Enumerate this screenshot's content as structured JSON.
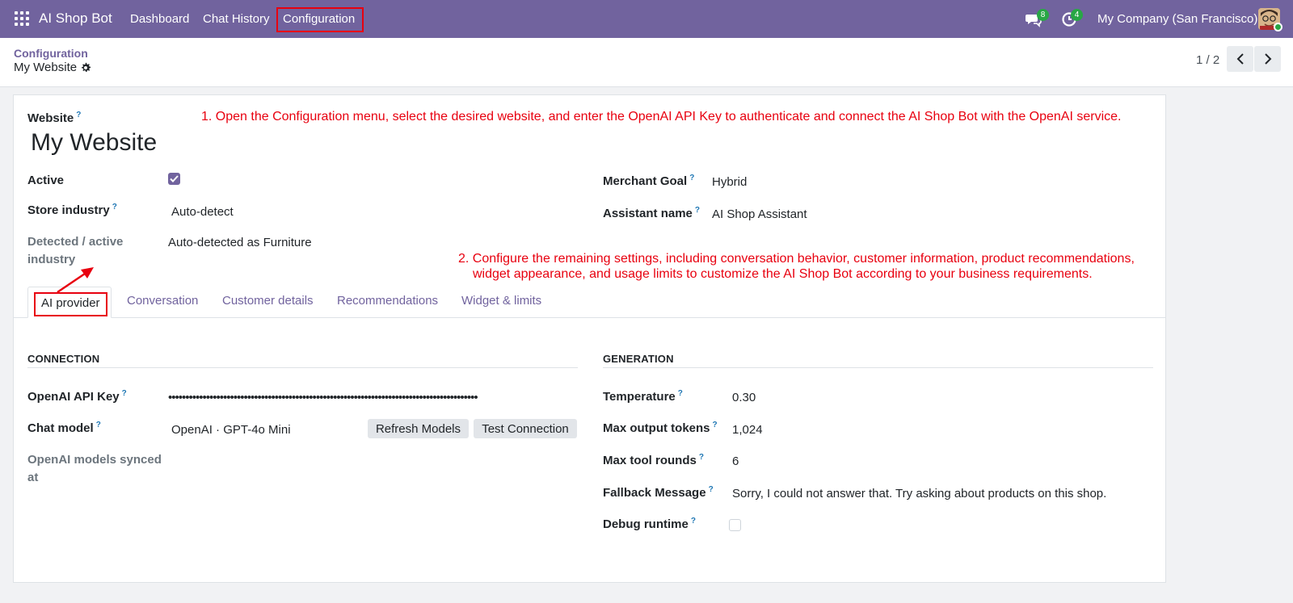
{
  "navbar": {
    "brand": "AI Shop Bot",
    "items": [
      "Dashboard",
      "Chat History",
      "Configuration"
    ],
    "messages_badge": "8",
    "activities_badge": "4",
    "company": "My Company (San Francisco)"
  },
  "control_panel": {
    "breadcrumb_parent": "Configuration",
    "breadcrumb_current": "My Website",
    "pager_value": "1 / 2"
  },
  "form": {
    "website_label": "Website",
    "website_name": "My Website",
    "active_label": "Active",
    "active_checked": true,
    "store_industry_label": "Store industry",
    "store_industry_value": "Auto-detect",
    "detected_label_line1": "Detected / active",
    "detected_label_line2": "industry",
    "detected_value": "Auto-detected as Furniture",
    "merchant_goal_label": "Merchant Goal",
    "merchant_goal_value": "Hybrid",
    "assistant_name_label": "Assistant name",
    "assistant_name_value": "AI Shop Assistant"
  },
  "annotations": {
    "step1": "1. Open the Configuration menu, select the desired website, and enter the OpenAI API Key to authenticate and connect the AI Shop Bot with the OpenAI service.",
    "step2_line1": "2. Configure the remaining settings, including conversation behavior, customer information, product recommendations,",
    "step2_line2": "widget appearance, and usage limits to customize the AI Shop Bot according to your business requirements."
  },
  "tabs": [
    "AI provider",
    "Conversation",
    "Customer details",
    "Recommendations",
    "Widget & limits"
  ],
  "connection": {
    "title": "CONNECTION",
    "api_key_label": "OpenAI API Key",
    "api_key_value": "••••••••••••••••••••••••••••••••••••••••••••••••••••••••••••••••••••••••••••••••••••••••••",
    "chat_model_label": "Chat model",
    "chat_model_value": "OpenAI · GPT-4o Mini",
    "refresh_button": "Refresh Models",
    "test_button": "Test Connection",
    "synced_label_line1": "OpenAI models synced",
    "synced_label_line2": "at"
  },
  "generation": {
    "title": "GENERATION",
    "temperature_label": "Temperature",
    "temperature_value": "0.30",
    "max_tokens_label": "Max output tokens",
    "max_tokens_value": "1,024",
    "max_rounds_label": "Max tool rounds",
    "max_rounds_value": "6",
    "fallback_label": "Fallback Message",
    "fallback_value": "Sorry, I could not answer that. Try asking about products on this shop.",
    "debug_label": "Debug runtime",
    "debug_checked": false
  },
  "colors": {
    "brand": "#71639e",
    "annotation": "#e8000f",
    "badge": "#28a745"
  }
}
